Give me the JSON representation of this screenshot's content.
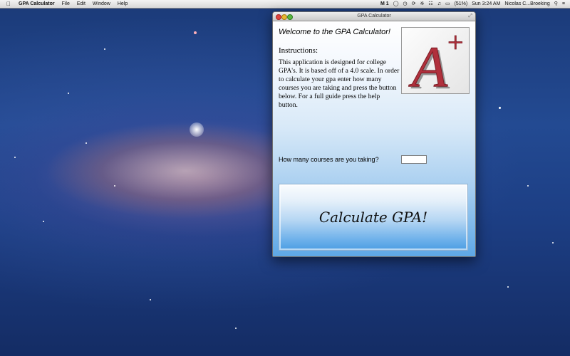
{
  "menubar": {
    "app_name": "GPA Calculator",
    "items": [
      "File",
      "Edit",
      "Window",
      "Help"
    ],
    "status": {
      "indicator": "1",
      "battery": "(51%)",
      "clock": "Sun 3:24 AM",
      "user": "Nicolas C...Broeking"
    }
  },
  "window": {
    "title": "GPA Calculator",
    "welcome": "Welcome to the GPA Calculator!",
    "instructions_title": "Instructions:",
    "instructions_text": "This application is designed for college GPA's. It is based off of a 4.0 scale. In order to calculate your gpa enter how many courses you are taking and press the button below. For a full guide press the help button.",
    "logo": {
      "letter": "A",
      "superscript": "+"
    },
    "courses_label": "How many courses are you taking?",
    "courses_value": "",
    "calculate_label": "Calculate GPA!"
  },
  "colors": {
    "logo_red": "#b0303c",
    "button_blue": "#5ea8e6",
    "desktop_blue": "#1f4288"
  }
}
